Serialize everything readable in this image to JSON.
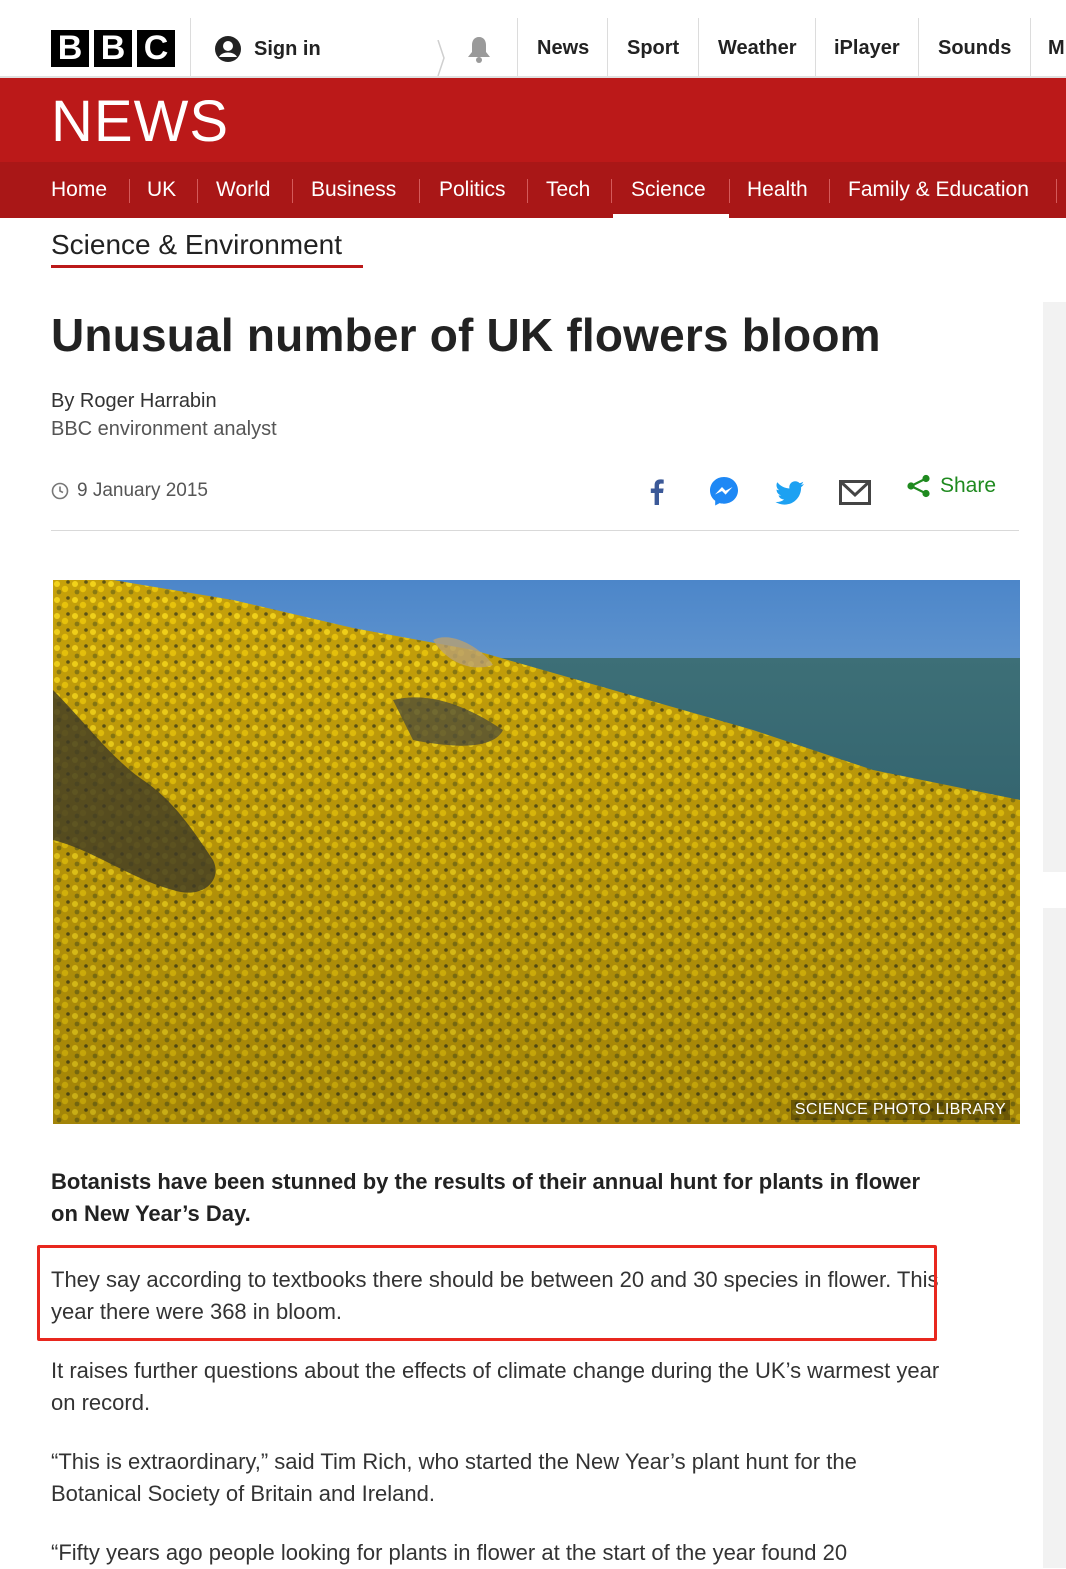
{
  "brand": {
    "letters": [
      "B",
      "B",
      "C"
    ],
    "news_wordmark": "NEWS"
  },
  "topbar": {
    "sign_in": "Sign in",
    "items": [
      "News",
      "Sport",
      "Weather",
      "iPlayer",
      "Sounds",
      "M"
    ]
  },
  "section_nav": {
    "items": [
      "Home",
      "UK",
      "World",
      "Business",
      "Politics",
      "Tech",
      "Science",
      "Health",
      "Family & Education"
    ],
    "active": "Science"
  },
  "section_header": "Science & Environment",
  "article": {
    "headline": "Unusual number of UK flowers bloom",
    "author": "By Roger Harrabin",
    "author_role": "BBC environment analyst",
    "date": "9 January 2015",
    "share_label": "Share",
    "image_credit": "SCIENCE PHOTO LIBRARY",
    "paragraphs": [
      "Botanists have been stunned by the results of their annual hunt for plants in flower on New Year’s Day.",
      "They say according to textbooks there should be between 20 and 30 species in flower. This year there were 368 in bloom.",
      "It raises further questions about the effects of climate change during the UK’s warmest year on record.",
      "“This is extraordinary,” said Tim Rich, who started the New Year’s plant hunt for the Botanical Society of Britain and Ireland.",
      "“Fifty years ago people looking for plants in flower at the start of the year found 20"
    ]
  },
  "icons": {
    "signin": "user-icon",
    "notifications": "bell-icon",
    "date": "clock-icon",
    "share": [
      "facebook-icon",
      "messenger-icon",
      "twitter-icon",
      "email-icon",
      "share-icon"
    ]
  },
  "colors": {
    "brand_red": "#bb1919",
    "nav_red": "#a91717",
    "highlight": "#e8271e",
    "share_green": "#1f8a1f"
  }
}
